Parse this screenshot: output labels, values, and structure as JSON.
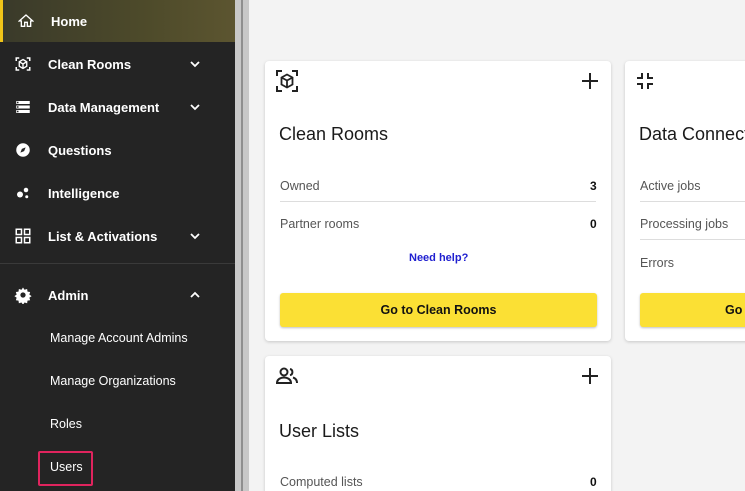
{
  "sidebar": {
    "home": "Home",
    "items": [
      {
        "label": "Clean Rooms",
        "icon": "cube-icon",
        "expandable": true
      },
      {
        "label": "Data Management",
        "icon": "storage-icon",
        "expandable": true
      },
      {
        "label": "Questions",
        "icon": "compass-icon",
        "expandable": false
      },
      {
        "label": "Intelligence",
        "icon": "bubbles-icon",
        "expandable": false
      },
      {
        "label": "List & Activations",
        "icon": "grid-icon",
        "expandable": true
      }
    ],
    "admin": {
      "label": "Admin",
      "icon": "gear-icon",
      "sub_items": [
        "Manage Account Admins",
        "Manage Organizations",
        "Roles",
        "Users"
      ]
    }
  },
  "cards": {
    "clean_rooms": {
      "title": "Clean Rooms",
      "rows": [
        {
          "label": "Owned",
          "value": "3"
        },
        {
          "label": "Partner rooms",
          "value": "0"
        }
      ],
      "help": "Need help?",
      "button": "Go to Clean Rooms"
    },
    "data_connect": {
      "title": "Data Connect",
      "rows": [
        {
          "label": "Active jobs"
        },
        {
          "label": "Processing jobs"
        },
        {
          "label": "Errors"
        }
      ],
      "button": "Go"
    },
    "user_lists": {
      "title": "User Lists",
      "rows": [
        {
          "label": "Computed lists",
          "value": "0"
        }
      ]
    }
  },
  "colors": {
    "sidebar_bg": "#242424",
    "accent_yellow": "#fbe034",
    "highlight_border": "#e0245e",
    "help_link": "#2020d0"
  }
}
